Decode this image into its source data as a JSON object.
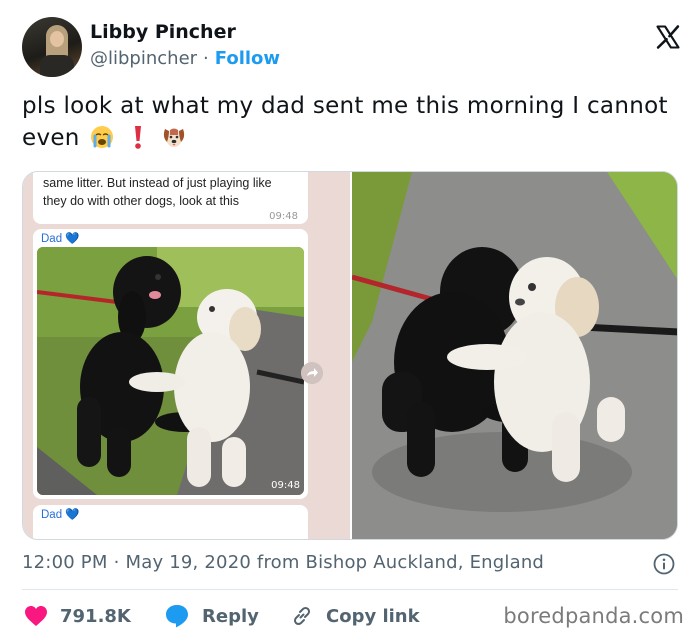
{
  "author": {
    "name": "Libby Pincher",
    "handle": "@libpincher",
    "separator": "·",
    "follow_label": "Follow"
  },
  "tweet": {
    "text": "pls look at what my dad sent me this morning I cannot even"
  },
  "chat": {
    "top_message": "same litter. But instead of just playing like they do with other dogs, look at this",
    "top_time": "09:48",
    "sender_name": "Dad 💙",
    "photo_time": "09:48",
    "bottom_sender_name": "Dad 💙"
  },
  "meta": {
    "time": "12:00 PM",
    "dot": "·",
    "date_location": "May 19, 2020 from Bishop Auckland, England"
  },
  "actions": {
    "likes_count": "791.8K",
    "reply_label": "Reply",
    "copy_link_label": "Copy link"
  },
  "watermark": "boredpanda.com",
  "colors": {
    "accent": "#1d9bf0",
    "like": "#f91880",
    "text": "#0f1419",
    "muted": "#536471"
  },
  "icons": [
    "x-logo-icon",
    "crying-emoji-icon",
    "exclamation-emoji-icon",
    "dog-emoji-icon",
    "forward-icon",
    "info-icon",
    "heart-icon",
    "reply-bubble-icon",
    "link-icon"
  ]
}
